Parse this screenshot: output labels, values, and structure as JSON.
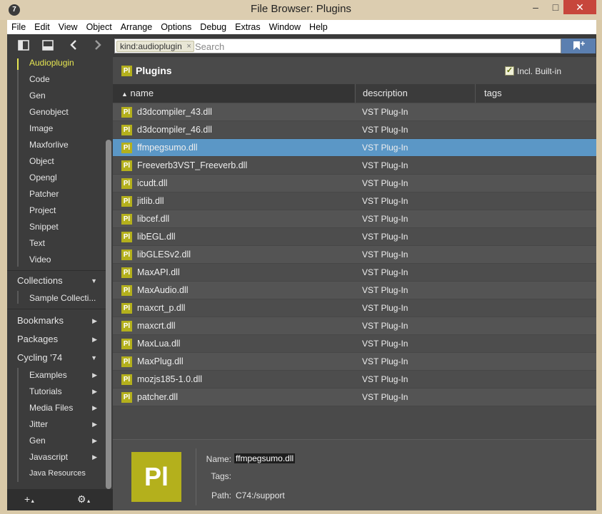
{
  "window": {
    "title": "File Browser: Plugins",
    "app_icon": "7",
    "controls": {
      "minimize": "–",
      "maximize": "□",
      "close": "✕"
    }
  },
  "menu": [
    "File",
    "Edit",
    "View",
    "Object",
    "Arrange",
    "Options",
    "Debug",
    "Extras",
    "Window",
    "Help"
  ],
  "sidebar": {
    "kinds": [
      "Audioplugin",
      "Code",
      "Gen",
      "Genobject",
      "Image",
      "Maxforlive",
      "Object",
      "Opengl",
      "Patcher",
      "Project",
      "Snippet",
      "Text",
      "Video"
    ],
    "active_kind": "Audioplugin",
    "collections": {
      "label": "Collections",
      "items": [
        "Sample Collecti..."
      ]
    },
    "bookmarks": "Bookmarks",
    "packages": "Packages",
    "cycling": {
      "label": "Cycling '74",
      "items": [
        "Examples",
        "Tutorials",
        "Media Files",
        "Jitter",
        "Gen",
        "Javascript",
        "Java Resources"
      ]
    },
    "bottom": {
      "add": "+",
      "settings": "⚙"
    }
  },
  "search": {
    "tag": "kind:audioplugin",
    "tag_remove": "×",
    "placeholder": "Search"
  },
  "header": {
    "badge": "Pl",
    "title": "Plugins",
    "builtin_label": "Incl. Built-in",
    "builtin_checked": true
  },
  "columns": {
    "name": "name",
    "description": "description",
    "tags": "tags",
    "sort_indicator": "▲"
  },
  "rows": [
    {
      "name": "d3dcompiler_43.dll",
      "description": "VST Plug-In"
    },
    {
      "name": "d3dcompiler_46.dll",
      "description": "VST Plug-In"
    },
    {
      "name": "ffmpegsumo.dll",
      "description": "VST Plug-In",
      "selected": true
    },
    {
      "name": "Freeverb3VST_Freeverb.dll",
      "description": "VST Plug-In"
    },
    {
      "name": "icudt.dll",
      "description": "VST Plug-In"
    },
    {
      "name": "jitlib.dll",
      "description": "VST Plug-In"
    },
    {
      "name": "libcef.dll",
      "description": "VST Plug-In"
    },
    {
      "name": "libEGL.dll",
      "description": "VST Plug-In"
    },
    {
      "name": "libGLESv2.dll",
      "description": "VST Plug-In"
    },
    {
      "name": "MaxAPI.dll",
      "description": "VST Plug-In"
    },
    {
      "name": "MaxAudio.dll",
      "description": "VST Plug-In"
    },
    {
      "name": "maxcrt_p.dll",
      "description": "VST Plug-In"
    },
    {
      "name": "maxcrt.dll",
      "description": "VST Plug-In"
    },
    {
      "name": "MaxLua.dll",
      "description": "VST Plug-In"
    },
    {
      "name": "MaxPlug.dll",
      "description": "VST Plug-In"
    },
    {
      "name": "mozjs185-1.0.dll",
      "description": "VST Plug-In"
    },
    {
      "name": "patcher.dll",
      "description": "VST Plug-In"
    }
  ],
  "details": {
    "badge": "Pl",
    "name_label": "Name:",
    "name_value": "ffmpegsumo.dll",
    "tags_label": "Tags:",
    "path_label": "Path:",
    "path_value": "C74:/support"
  },
  "colors": {
    "accent_yellow": "#e6e652",
    "badge_olive": "#b4b01c",
    "selection_blue": "#5b97c6",
    "close_red": "#c7463c"
  }
}
